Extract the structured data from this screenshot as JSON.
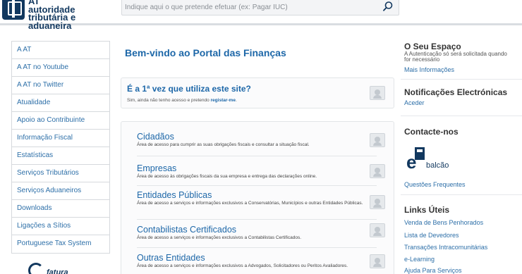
{
  "header": {
    "logo_line1": "AT",
    "logo_line2": "autoridade",
    "logo_line3": "tributária e aduaneira",
    "search_placeholder": "Indique aqui o que pretende efetuar (ex: Pagar IUC)"
  },
  "leftnav": {
    "items": [
      "A AT",
      "A AT no Youtube",
      "A AT no Twitter",
      "Atualidade",
      "Apoio ao Contribuinte",
      "Informação Fiscal",
      "Estatísticas",
      "Serviços Tributários",
      "Serviços Aduaneiros",
      "Downloads",
      "Ligações a Sítios",
      "Portuguese Tax System"
    ],
    "fatura_label": "fatura"
  },
  "main": {
    "welcome": "Bem-vindo ao Portal das Finanças",
    "first_time": {
      "title": "É a 1ª vez que utiliza este site?",
      "subtitle_prefix": "Sim, ainda não tenho acesso e pretendo ",
      "subtitle_link": "registar-me",
      "subtitle_suffix": "."
    },
    "entries": [
      {
        "title": "Cidadãos",
        "desc": "Área de acesso para cumprir as suas obrigações fiscais e consultar a situação fiscal."
      },
      {
        "title": "Empresas",
        "desc": "Área de acesso às obrigações fiscais da sua empresa e entrega das declarações online."
      },
      {
        "title": "Entidades Públicas",
        "desc": "Área de acesso a serviços e informações exclusivos a Conservatórias, Municípios e outras Entidades Públicas."
      },
      {
        "title": "Contabilistas Certificados",
        "desc": "Área de acesso a serviços e informações exclusivos a Contabilistas Certificados."
      },
      {
        "title": "Outras Entidades",
        "desc": "Área de acesso a serviços e informações exclusivos a Advogados, Solicitadores ou Peritos Avaliadores."
      }
    ]
  },
  "right": {
    "espaco_title": "O Seu Espaço",
    "espaco_note": "A Autenticação só será solicitada quando for necessário",
    "espaco_link": "Mais Informações",
    "notif_title": "Notificações Electrónicas",
    "notif_link": "Aceder",
    "contact_title": "Contacte-nos",
    "ebalcao_label": "balcão",
    "faq_link": "Questões Frequentes",
    "links_title": "Links Úteis",
    "links": [
      "Venda de Bens Penhorados",
      "Lista de Devedores",
      "Transações Intracomunitárias",
      "e-Learning",
      "Ajuda Para Serviços"
    ]
  }
}
